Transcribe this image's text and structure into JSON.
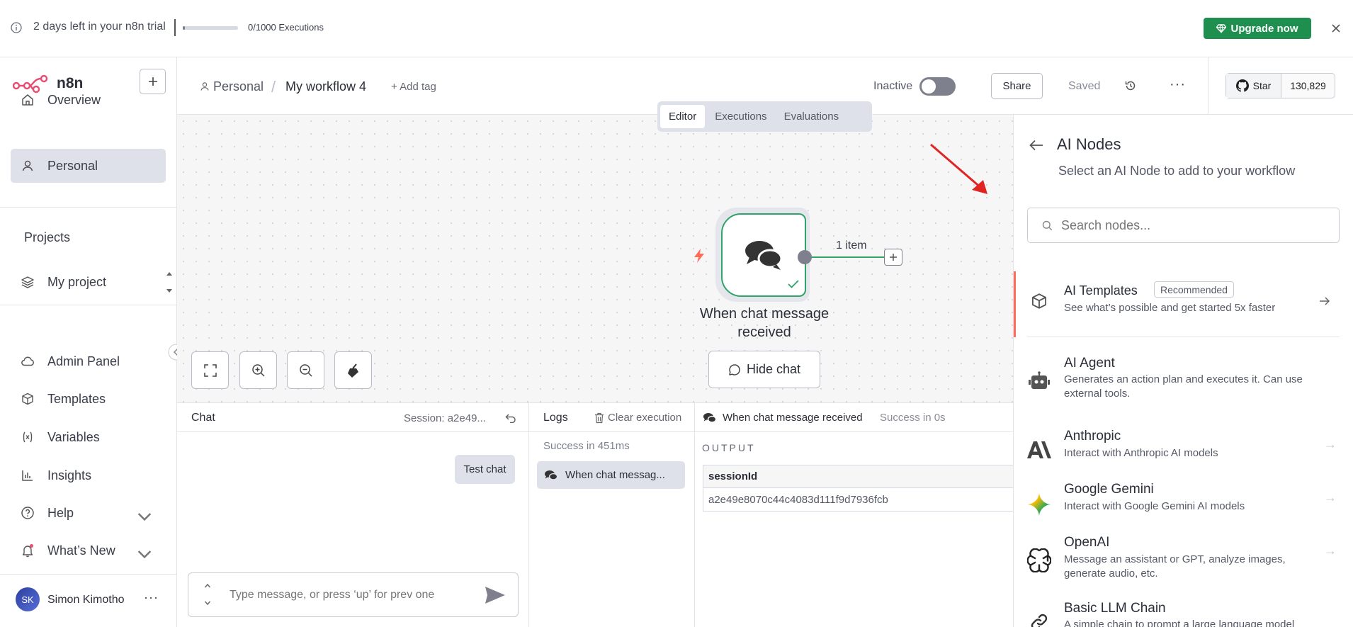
{
  "banner": {
    "trial_text": "2 days left in your n8n trial",
    "executions": "0/1000 Executions",
    "executions_progress": 0.02,
    "upgrade_label": "Upgrade now"
  },
  "sidebar": {
    "logo_text": "n8n",
    "items": [
      {
        "label": "Overview",
        "icon": "home-icon"
      },
      {
        "label": "Personal",
        "icon": "user-icon",
        "active": true
      }
    ],
    "projects_heading": "Projects",
    "project_item": "My project",
    "bottom_items": [
      {
        "label": "Admin Panel",
        "icon": "cloud-icon"
      },
      {
        "label": "Templates",
        "icon": "box-icon"
      },
      {
        "label": "Variables",
        "icon": "variable-icon"
      },
      {
        "label": "Insights",
        "icon": "chart-icon"
      },
      {
        "label": "Help",
        "icon": "help-icon"
      },
      {
        "label": "What’s New",
        "icon": "bell-icon"
      }
    ],
    "user": {
      "initials": "SK",
      "name": "Simon Kimotho"
    }
  },
  "header": {
    "breadcrumb_project": "Personal",
    "breadcrumb_sep": "/",
    "workflow_name": "My workflow 4",
    "add_tag": "+ Add tag",
    "inactive_label": "Inactive",
    "share_label": "Share",
    "saved_label": "Saved",
    "star_label": "Star",
    "star_count": "130,829"
  },
  "tabs": [
    "Editor",
    "Executions",
    "Evaluations"
  ],
  "canvas": {
    "node_label_line1": "When chat message",
    "node_label_line2": "received",
    "connection_label": "1 item",
    "hide_chat_label": "Hide chat"
  },
  "chat": {
    "title": "Chat",
    "session": "Session: a2e49...",
    "message": "Test chat",
    "input_placeholder": "Type message, or press ‘up’ for prev one"
  },
  "logs": {
    "title": "Logs",
    "clear_label": "Clear execution",
    "status": "Success in 451ms",
    "entry": "When chat messag..."
  },
  "output": {
    "node_name": "When chat message received",
    "status": "Success in 0s",
    "heading": "OUTPUT",
    "field_name": "sessionId",
    "field_value": "a2e49e8070c44c4083d111f9d7936fcb"
  },
  "ai_panel": {
    "title": "AI Nodes",
    "subtitle": "Select an AI Node to add to your workflow",
    "search_placeholder": "Search nodes...",
    "templates": {
      "title": "AI Templates",
      "badge": "Recommended",
      "desc": "See what’s possible and get started 5x faster"
    },
    "nodes": [
      {
        "title": "AI Agent",
        "desc": "Generates an action plan and executes it. Can use external tools.",
        "icon": "robot-icon"
      },
      {
        "title": "Anthropic",
        "desc": "Interact with Anthropic AI models",
        "icon": "anthropic-icon"
      },
      {
        "title": "Google Gemini",
        "desc": "Interact with Google Gemini AI models",
        "icon": "gemini-icon"
      },
      {
        "title": "OpenAI",
        "desc": "Message an assistant or GPT, analyze images, generate audio, etc.",
        "icon": "openai-icon"
      },
      {
        "title": "Basic LLM Chain",
        "desc": "A simple chain to prompt a large language model",
        "icon": "link-icon"
      }
    ]
  },
  "colors": {
    "accent_green": "#1e8f4e",
    "brand_red": "#ea4b71",
    "node_border": "#2ea36a"
  }
}
